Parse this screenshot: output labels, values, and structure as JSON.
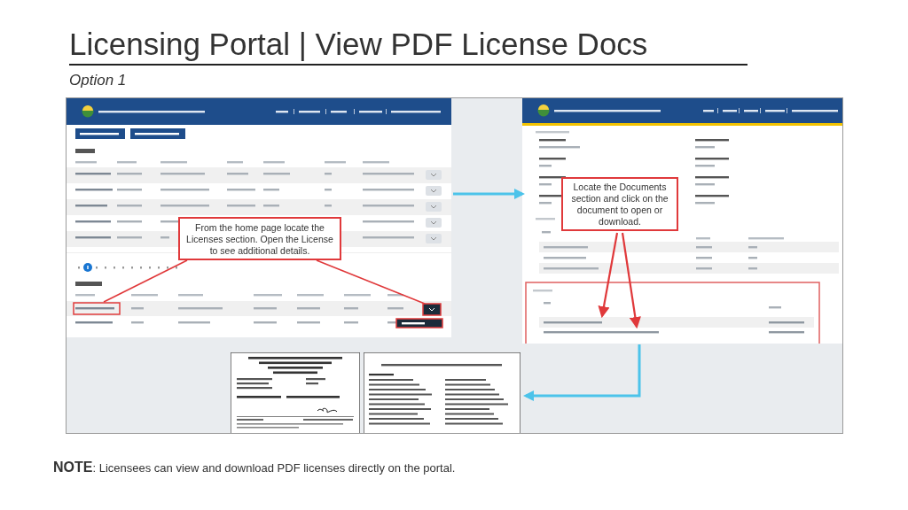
{
  "title": "Licensing Portal | View PDF License Docs",
  "subtitle": "Option 1",
  "callouts": [
    "From the home page locate the Licenses section.  Open the License to see additional details.",
    "Locate the Documents section and click on the document to open or download."
  ],
  "note": "**NOTE**: Licensees can view and download PDF licenses directly on the portal."
}
